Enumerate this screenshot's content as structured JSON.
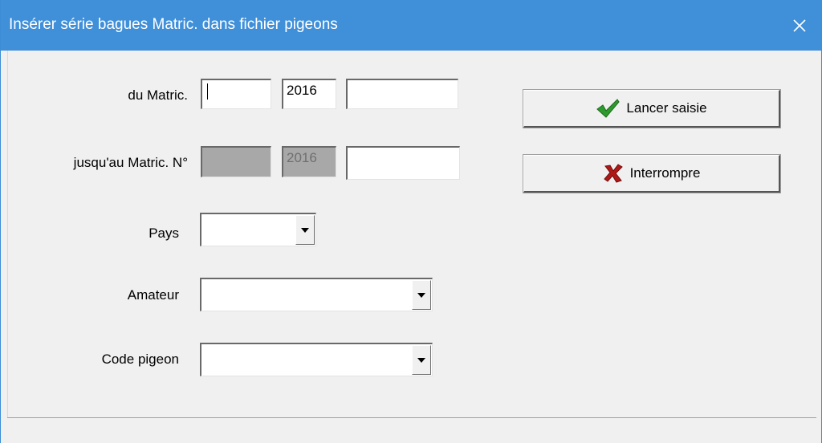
{
  "window": {
    "title": "Insérer série bagues Matric. dans fichier pigeons",
    "titlebar_color": "#3f8fd9"
  },
  "form": {
    "from_label": "du Matric.",
    "from_field1_value": "",
    "from_year_value": "2016",
    "from_field3_value": "",
    "to_label": "jusqu'au Matric. N°",
    "to_field1_value": "",
    "to_year_value": "2016",
    "to_field3_value": "",
    "pays_label": "Pays",
    "pays_value": "",
    "amateur_label": "Amateur",
    "amateur_value": "",
    "code_label": "Code pigeon",
    "code_value": ""
  },
  "buttons": {
    "start_label": "Lancer saisie",
    "start_icon": "checkmark-icon",
    "start_icon_color": "#2e9a2e",
    "stop_label": "Interrompre",
    "stop_icon": "red-x-icon",
    "stop_icon_color": "#b01818"
  }
}
